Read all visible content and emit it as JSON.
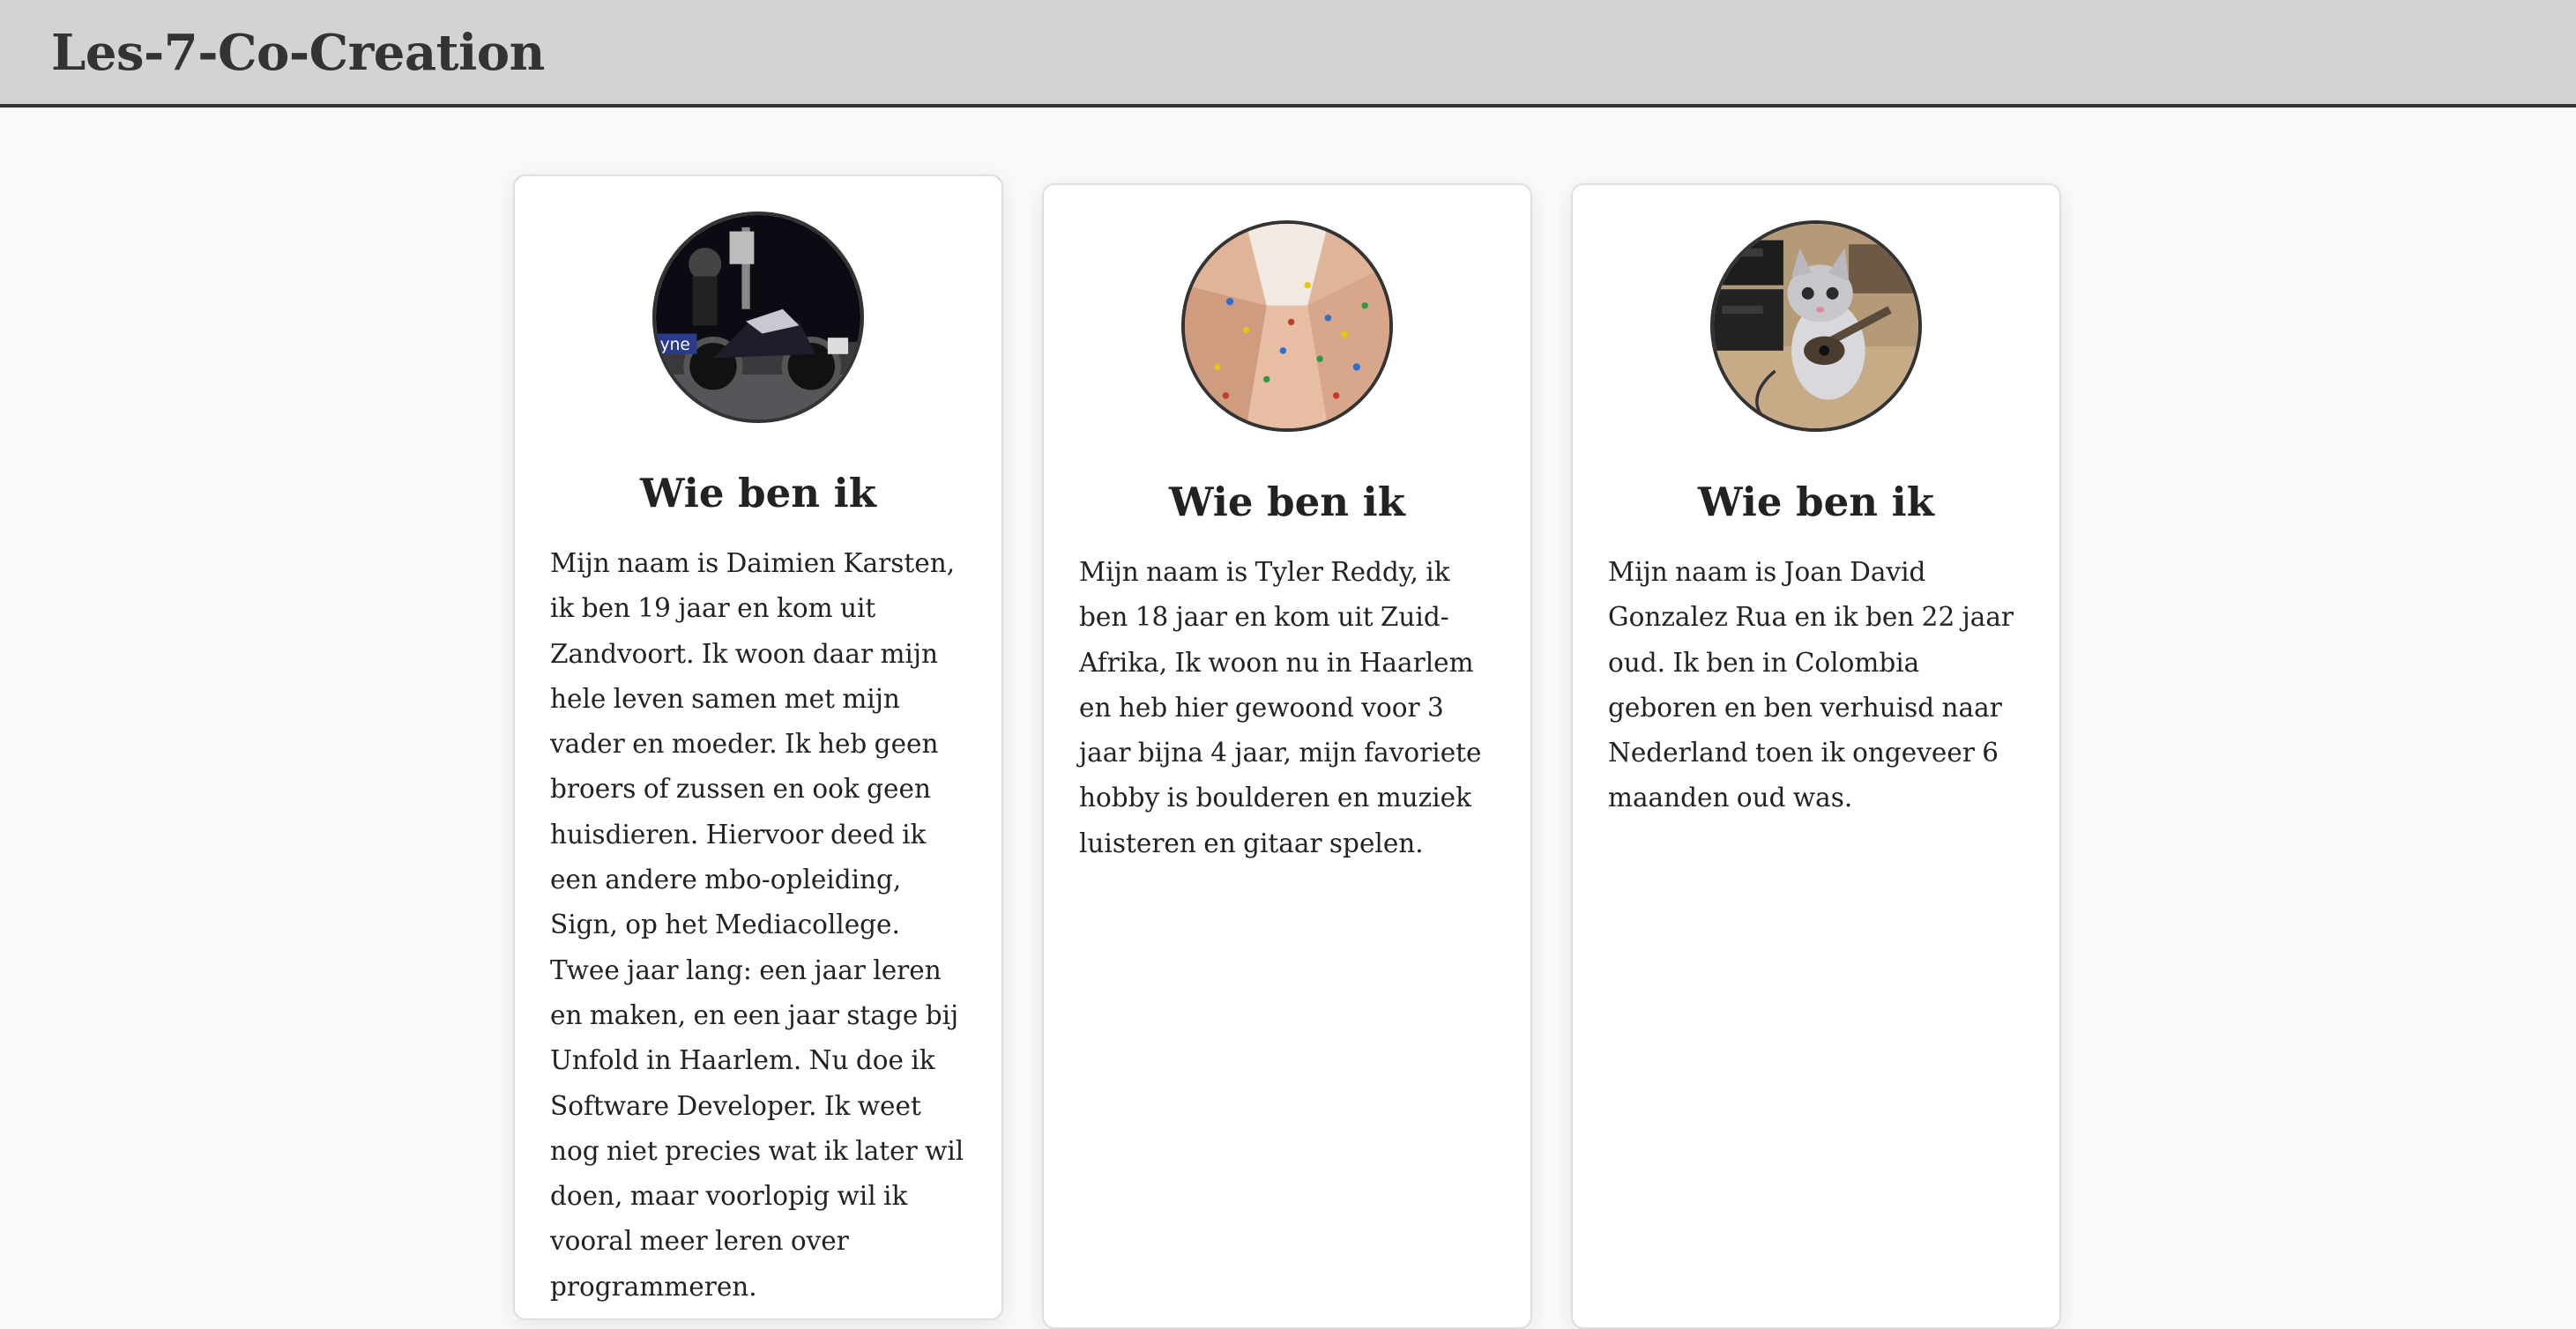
{
  "header": {
    "title": "Les-7-Co-Creation"
  },
  "cards": [
    {
      "heading": "Wie ben ik",
      "avatar_icon": "motorcycle-photo",
      "text": "Mijn naam is Daimien Karsten, ik ben 19 jaar en kom uit Zandvoort. Ik woon daar mijn hele leven samen met mijn vader en moeder. Ik heb geen broers of zussen en ook geen huisdieren. Hiervoor deed ik een andere mbo-opleiding, Sign, op het Mediacollege. Twee jaar lang: een jaar leren en maken, en een jaar stage bij Unfold in Haarlem. Nu doe ik Software Developer. Ik weet nog niet precies wat ik later wil doen, maar voorlopig wil ik vooral meer leren over programmeren."
    },
    {
      "heading": "Wie ben ik",
      "avatar_icon": "climbing-wall-photo",
      "text": "Mijn naam is Tyler Reddy, ik ben 18 jaar en kom uit Zuid-Afrika, Ik woon nu in Haarlem en heb hier gewoond voor 3 jaar bijna 4 jaar, mijn favoriete hobby is boulderen en muziek luisteren en gitaar spelen."
    },
    {
      "heading": "Wie ben ik",
      "avatar_icon": "kitten-guitar-photo",
      "text": "Mijn naam is Joan David Gonzalez Rua en ik ben 22 jaar oud. Ik ben in Colombia geboren en ben verhuisd naar Nederland toen ik ongeveer 6 maanden oud was."
    }
  ],
  "colors": {
    "header_bg": "#d3d3d3",
    "page_bg": "#f9f9f9",
    "card_bg": "#ffffff",
    "text": "#222222"
  }
}
